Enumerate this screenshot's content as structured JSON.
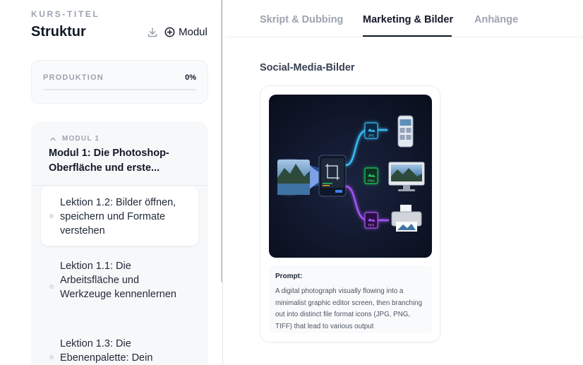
{
  "sidebar": {
    "course_label": "KURS-TITEL",
    "title": "Struktur",
    "download_icon": "download-icon",
    "add_module_label": "Modul",
    "progress": {
      "label": "PRODUKTION",
      "value_text": "0%",
      "value": 0
    },
    "module": {
      "label": "MODUL 1",
      "title": "Modul 1: Die Photoshop-Oberfläche und erste...",
      "lessons": [
        {
          "label": "Lektion 1.2: Bilder öffnen, speichern und Formate verstehen",
          "active": true
        },
        {
          "label": "Lektion 1.1: Die Arbeitsfläche und Werkzeuge kennenlernen",
          "active": false
        },
        {
          "label": "Lektion 1.3: Die Ebenenpalette: Dein",
          "active": false
        }
      ]
    }
  },
  "tabs": [
    {
      "label": "Skript & Dubbing",
      "active": false
    },
    {
      "label": "Marketing & Bilder",
      "active": true
    },
    {
      "label": "Anhänge",
      "active": false
    }
  ],
  "main": {
    "section_title": "Social-Media-Bilder",
    "image_card": {
      "image_labels": [
        "JPG",
        "PNG",
        "TIFF"
      ],
      "prompt_label": "Prompt:",
      "prompt_text": "A digital photograph visually flowing into a minimalist graphic editor screen, then branching out into distinct file format icons (JPG, PNG, TIFF) that lead to various output"
    }
  },
  "colors": {
    "accent": "#111827",
    "muted": "#9ca3af",
    "panel": "#f7f8fa",
    "image_bg": "#0b1020",
    "jpg": "#38bdf8",
    "png": "#22c55e",
    "tiff": "#a855f7"
  }
}
